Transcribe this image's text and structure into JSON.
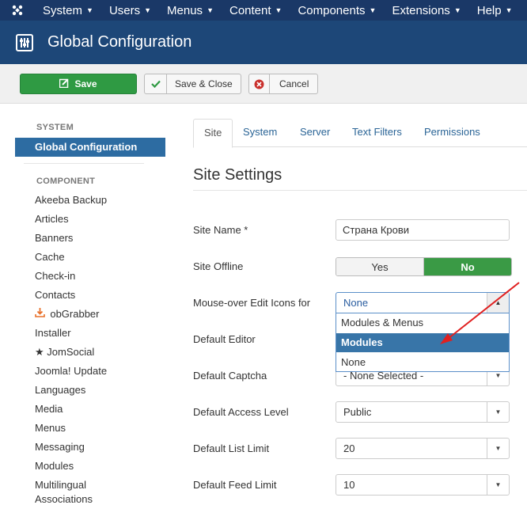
{
  "topnav": {
    "logo_icon": "joomla-logo-icon",
    "items": [
      "System",
      "Users",
      "Menus",
      "Content",
      "Components",
      "Extensions",
      "Help"
    ]
  },
  "header": {
    "icon": "sliders-icon",
    "title": "Global Configuration"
  },
  "toolbar": {
    "save_label": "Save",
    "save_close_label": "Save & Close",
    "cancel_label": "Cancel"
  },
  "sidebar": {
    "system_heading": "SYSTEM",
    "active_item": "Global Configuration",
    "component_heading": "COMPONENT",
    "items": [
      "Akeeba Backup",
      "Articles",
      "Banners",
      "Cache",
      "Check-in",
      "Contacts",
      "obGrabber",
      "Installer",
      "JomSocial",
      "Joomla! Update",
      "Languages",
      "Media",
      "Menus",
      "Messaging",
      "Modules",
      "Multilingual",
      "Associations"
    ]
  },
  "tabs": [
    "Site",
    "System",
    "Server",
    "Text Filters",
    "Permissions"
  ],
  "content": {
    "section_title": "Site Settings",
    "site_name_label": "Site Name *",
    "site_name_value": "Страна Крови",
    "site_offline_label": "Site Offline",
    "offline_yes": "Yes",
    "offline_no": "No",
    "mouseover_label": "Mouse-over Edit Icons for",
    "mouseover_value": "None",
    "mouseover_options": [
      "Modules & Menus",
      "Modules",
      "None"
    ],
    "default_editor_label": "Default Editor",
    "default_captcha_label": "Default Captcha",
    "default_captcha_value": "- None Selected -",
    "default_access_label": "Default Access Level",
    "default_access_value": "Public",
    "list_limit_label": "Default List Limit",
    "list_limit_value": "20",
    "feed_limit_label": "Default Feed Limit",
    "feed_limit_value": "10"
  },
  "colors": {
    "nav_bg": "#1a3867",
    "header_bg": "#1d4778",
    "save_green": "#2f9a43",
    "active_blue": "#2d6ca2",
    "annotation_red": "#e02020"
  }
}
